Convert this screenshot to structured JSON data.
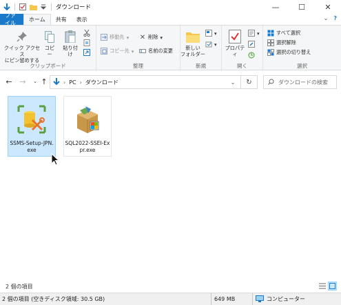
{
  "window": {
    "title": "ダウンロード",
    "controls": [
      "—",
      "☐",
      "✕"
    ]
  },
  "tabs": [
    {
      "label": "ファイル"
    },
    {
      "label": "ホーム"
    },
    {
      "label": "共有"
    },
    {
      "label": "表示"
    }
  ],
  "ribbon": {
    "clipboard": {
      "label": "クリップボード",
      "pin": "クイック アクセス\nにピン留めする",
      "copy": "コピー",
      "paste": "貼り付け"
    },
    "organize": {
      "label": "整理",
      "move": "移動先",
      "copyto": "コピー先",
      "delete": "削除",
      "rename": "名前の変更"
    },
    "new": {
      "label": "新規",
      "folder": "新しい\nフォルダー"
    },
    "open": {
      "label": "開く",
      "properties": "プロパティ"
    },
    "select": {
      "label": "選択",
      "all": "すべて選択",
      "none": "選択解除",
      "invert": "選択の切り替え"
    }
  },
  "address": {
    "path": [
      "PC",
      "ダウンロード"
    ],
    "search_placeholder": "ダウンロードの検索"
  },
  "files": [
    {
      "name": "SSMS-Setup-JPN.exe",
      "selected": true
    },
    {
      "name": "SQL2022-SSEI-Expr.exe",
      "selected": false
    }
  ],
  "status": {
    "item_count": "2 個の項目",
    "disk_info": "2 個の項目 (空きディスク領域: 30.5 GB)",
    "size": "649 MB",
    "location": "コンピューター"
  },
  "colors": {
    "accent": "#1979ca",
    "selection": "#cce8ff"
  }
}
